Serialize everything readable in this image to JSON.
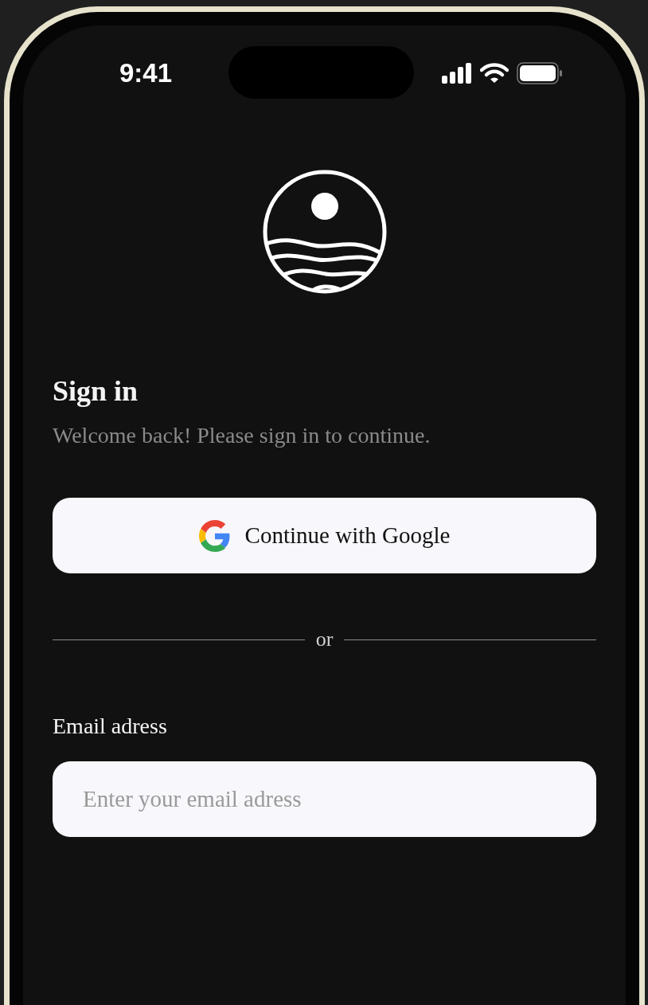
{
  "status_bar": {
    "time": "9:41"
  },
  "title": "Sign in",
  "subtitle": "Welcome back! Please sign in to continue.",
  "google_button": {
    "label": "Continue with Google"
  },
  "divider": {
    "label": "or"
  },
  "email_field": {
    "label": "Email adress",
    "placeholder": "Enter your email adress"
  }
}
